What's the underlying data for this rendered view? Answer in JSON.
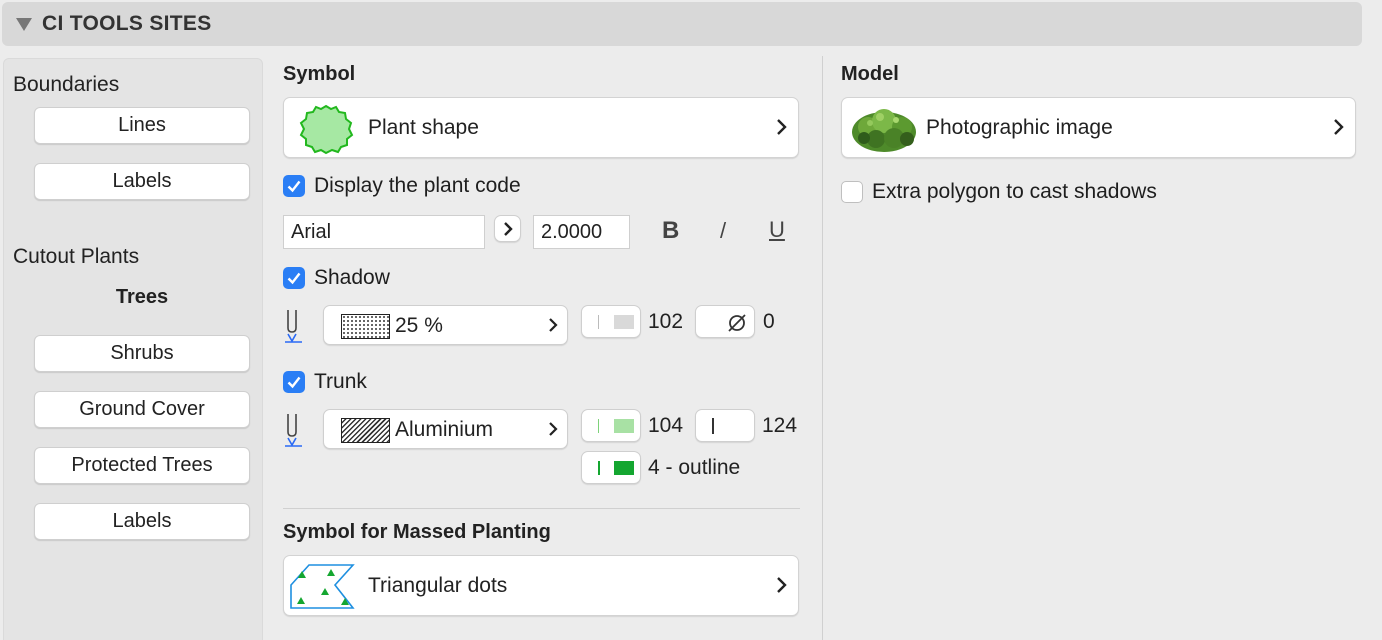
{
  "header": {
    "title": "CI TOOLS SITES"
  },
  "sidebar": {
    "boundaries_title": "Boundaries",
    "boundaries_buttons": [
      "Lines",
      "Labels"
    ],
    "cutout_title": "Cutout Plants",
    "cutout_selected": "Trees",
    "cutout_buttons": [
      "Shrubs",
      "Ground Cover",
      "Protected Trees",
      "Labels"
    ]
  },
  "symbol": {
    "title": "Symbol",
    "shape_label": "Plant shape",
    "display_code_label": "Display the plant code",
    "display_code_checked": true,
    "font_value": "Arial",
    "size_value": "2.0000",
    "bold_label": "B",
    "italic_label": "/",
    "underline_label": "U",
    "shadow_label": "Shadow",
    "shadow_checked": true,
    "shadow_fill": "25 %",
    "shadow_pen": "102",
    "shadow_bg_pen": "0",
    "trunk_label": "Trunk",
    "trunk_checked": true,
    "trunk_fill": "Aluminium",
    "trunk_pen": "104",
    "trunk_bg_pen": "124",
    "trunk_outline": "4 - outline"
  },
  "massed": {
    "title": "Symbol for Massed Planting",
    "pattern_label": "Triangular dots"
  },
  "model": {
    "title": "Model",
    "image_label": "Photographic image",
    "extra_polygon_label": "Extra polygon to cast shadows",
    "extra_polygon_checked": false
  },
  "colors": {
    "accent": "#2a7ef5",
    "plant_fill": "#a6e8a3",
    "plant_stroke": "#22b81e",
    "pen_102": "#d9d9d9",
    "pen_104": "#a8e1a4",
    "pen_outline": "#14a630"
  }
}
